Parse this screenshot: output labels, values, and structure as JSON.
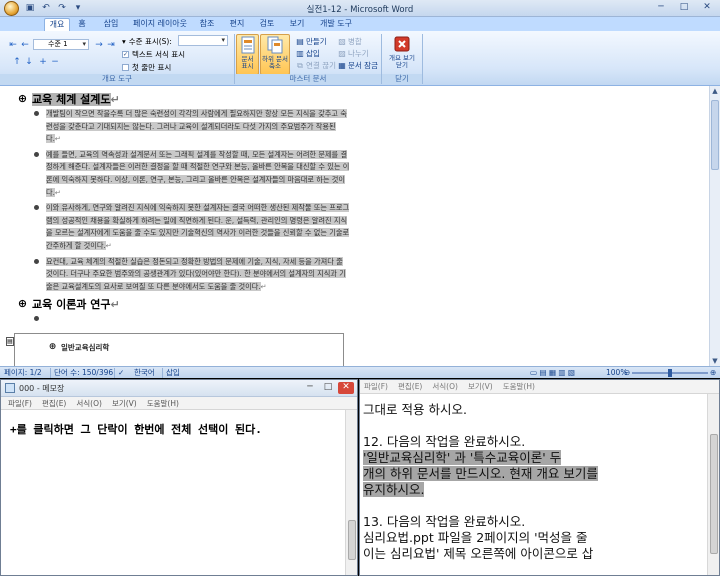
{
  "word": {
    "title": "실전1-12 - Microsoft Word",
    "qat": {
      "save_icon": "save-icon",
      "undo_icon": "undo-icon",
      "redo_icon": "redo-icon",
      "customize_icon": "customize-icon"
    },
    "window_controls": {
      "minimize": "─",
      "maximize": "□",
      "close": "✕"
    },
    "tabs": [
      "개요",
      "홈",
      "삽입",
      "페이지 레이아웃",
      "참조",
      "편지",
      "검토",
      "보기",
      "개발 도구"
    ],
    "active_tab": "개요",
    "ribbon": {
      "outline_group_label": "개요 도구",
      "level_value": "수준 1",
      "show_level_label": "수준 표시(S):",
      "show_text_format_label": "텍스트 서식 표시",
      "show_first_line_label": "첫 줄만 표시",
      "show_document_label": "문서\n표시",
      "collapse_subdoc_label": "하위 문서\n축소",
      "master_group_label": "마스터 문서",
      "create_label": "만들기",
      "insert_label": "삽입",
      "unlink_label": "연결 끊기",
      "merge_label": "병합",
      "split_label": "나누기",
      "lock_label": "문서 잠금",
      "close_outline_label": "개요 보기\n닫기",
      "close_group_label": "닫기"
    },
    "doc": {
      "heading1": "교육 체계 설계도",
      "paragraphs": [
        "개발팀이 작으면 작을수록 더 많은 숙련성이 각각의 사람에게 필요하지만 항상 모든 지식을 갖추고 숙련성을 갖춘다고 기대되지는 않는다. 그러나 교육이 설계되더라도 다섯 가지의 주요범주가 작용된다.",
        "예를 들면, 교육의 역속성과 설계문서 또는 그래픽 설계를 작성할 때, 모든 설계자는 어려한 문제를 결정하게 해준다. 설계자들은 이러한 결정을 할 때 적절한 연구와 본능, 올바른 안목을 대신할 수 있는 이론에 익숙하지 못하다. 이상, 이론, 연구, 본능, 그리고 올바른 안목은 설계자들의 마음대로 하는 것이다.",
        "이와 유사하게, 연구와 알려진 지식에 익숙하지 못한 설계자는 결국 어떠한 생산된 제작물 또는 프로그램의 성공적인 채용을 확실하게 하려는 일에 직면하게 된다. 운, 설득력, 관리인의 명령은 알려진 지식을 모르는 설계자에게 도움을 줄 수도 있지만 기술혁신의 역사가 이러한 것들을 신뢰할 수 없는 기술로 간주하게 할 것이다.",
        "요컨대, 교육 체계의 적절한 실습은 정돈되고 정확한 방법의 문제에 기술, 지식, 자세 등을 가져다 줄 것이다. 더구나 주요한 범주와의 공생관계가 있다(있어야만 한다). 한 분야에서의 설계자의 지식과 기술은 교육설계도의 요사로 보여질 또 다른 분야에서도 도움을 줄 것이다."
      ],
      "heading2": "교육 이론과 연구",
      "subdoc_title": "일반교육심리학"
    },
    "status": {
      "page": "페이지: 1/2",
      "words": "단어 수: 150/396",
      "lang": "한국어",
      "mode": "삽입",
      "zoom": "100%"
    }
  },
  "notepad": {
    "title": "000 - 메모장",
    "menu": [
      "파일(F)",
      "편집(E)",
      "서식(O)",
      "보기(V)",
      "도움말(H)"
    ],
    "text": "+를 클릭하면 그 단락이 한번에 전체 선택이 된다."
  },
  "viewer": {
    "menu": [
      "파일(F)",
      "편집(E)",
      "서식(O)",
      "보기(V)",
      "도움말(H)"
    ],
    "lines": [
      {
        "text": "그대로 적용 하시오.",
        "sel": false
      },
      {
        "text": "",
        "sel": false
      },
      {
        "text": "12. 다음의 작업을 완료하시오.",
        "sel": false
      },
      {
        "text": "'일반교육심리학'  과  '특수교육이론'  두",
        "sel": true
      },
      {
        "text": "개의 하위 문서를 만드시오. 현재 개요 보기를",
        "sel": true
      },
      {
        "text": "유지하시오.",
        "sel": true
      },
      {
        "text": "",
        "sel": false
      },
      {
        "text": "13. 다음의 작업을 완료하시오.",
        "sel": false
      },
      {
        "text": "   심리요법.ppt 파일을 2페이지의  '먹성을 줄",
        "sel": false
      },
      {
        "text": "이는 심리요법'  제목 오른쪽에 아이콘으로 삽",
        "sel": false
      }
    ]
  }
}
